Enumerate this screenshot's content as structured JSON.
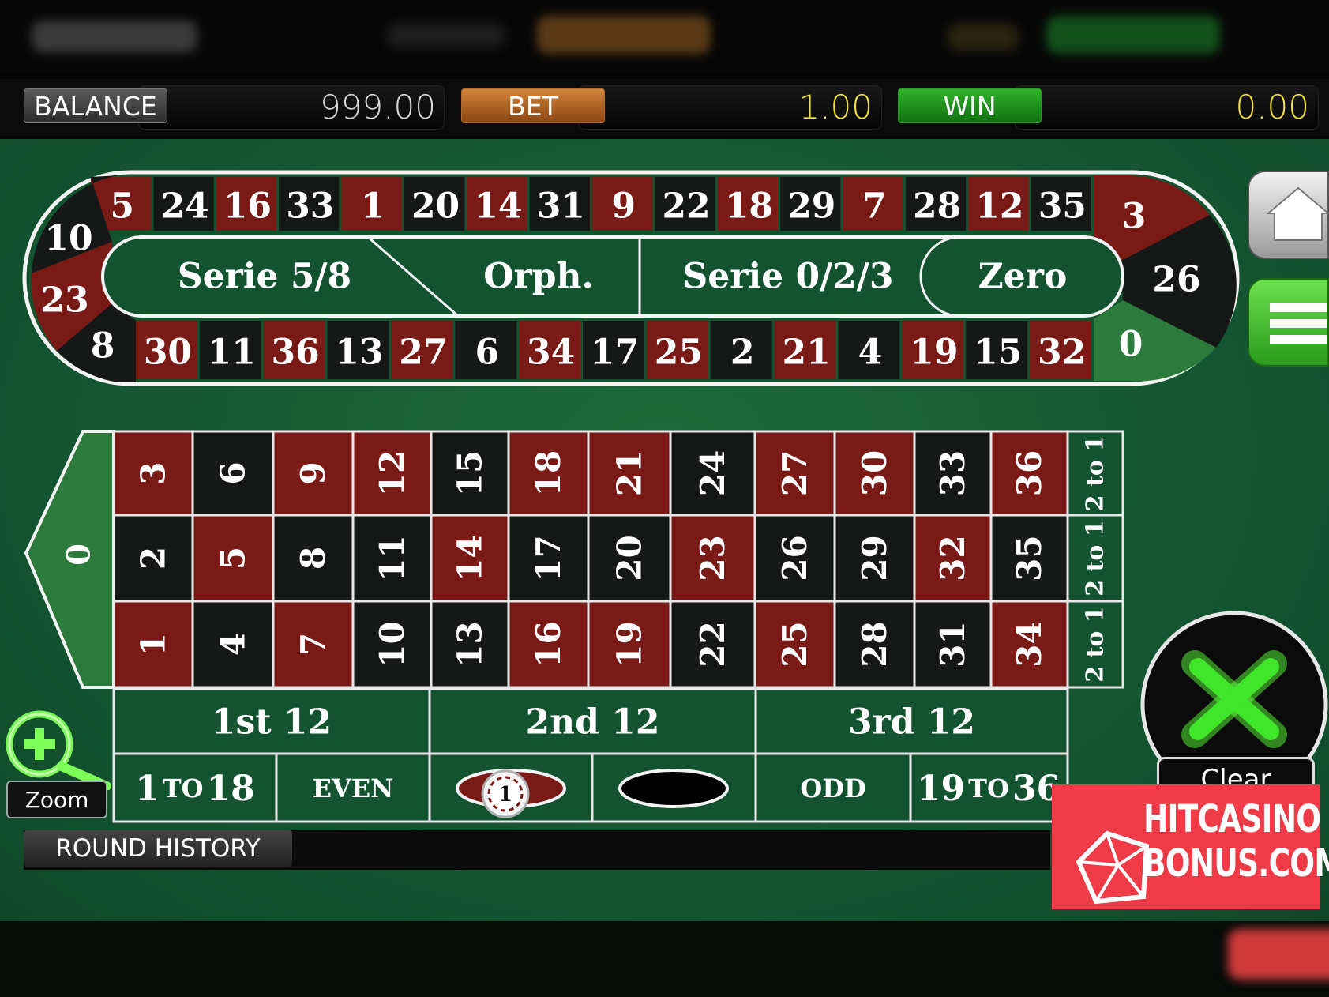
{
  "stats": {
    "balance_label": "BALANCE",
    "balance_value": "999.00",
    "bet_label": "BET",
    "bet_value": "1.00",
    "win_label": "WIN",
    "win_value": "0.00"
  },
  "racetrack": {
    "top_numbers": [
      "5",
      "24",
      "16",
      "33",
      "1",
      "20",
      "14",
      "31",
      "9",
      "22",
      "18",
      "29",
      "7",
      "28",
      "12",
      "35"
    ],
    "top_colors": [
      "red",
      "black",
      "red",
      "black",
      "red",
      "black",
      "red",
      "black",
      "red",
      "black",
      "red",
      "black",
      "red",
      "black",
      "red",
      "black"
    ],
    "bottom_numbers": [
      "30",
      "11",
      "36",
      "13",
      "27",
      "6",
      "34",
      "17",
      "25",
      "2",
      "21",
      "4",
      "19",
      "15",
      "32"
    ],
    "bottom_colors": [
      "red",
      "black",
      "red",
      "black",
      "red",
      "black",
      "red",
      "black",
      "red",
      "black",
      "red",
      "black",
      "red",
      "black",
      "red"
    ],
    "left_numbers": [
      "10",
      "23",
      "8"
    ],
    "right_numbers": [
      "3",
      "26",
      "0"
    ],
    "sections": [
      "Serie 5/8",
      "Orph.",
      "Serie 0/2/3",
      "Zero"
    ]
  },
  "table": {
    "zero": "0",
    "rows": [
      [
        "3",
        "6",
        "9",
        "12",
        "15",
        "18",
        "21",
        "24",
        "27",
        "30",
        "33",
        "36"
      ],
      [
        "2",
        "5",
        "8",
        "11",
        "14",
        "17",
        "20",
        "23",
        "26",
        "29",
        "32",
        "35"
      ],
      [
        "1",
        "4",
        "7",
        "10",
        "13",
        "16",
        "19",
        "22",
        "25",
        "28",
        "31",
        "34"
      ]
    ],
    "red_numbers": [
      1,
      3,
      5,
      7,
      9,
      12,
      14,
      16,
      18,
      19,
      21,
      23,
      25,
      27,
      30,
      32,
      34,
      36
    ],
    "column_bet_label": "2 to 1",
    "dozens": [
      "1st 12",
      "2nd 12",
      "3rd 12"
    ],
    "outside": {
      "low_a": "1",
      "low_b": "TO",
      "low_c": "18",
      "even": "EVEN",
      "odd": "ODD",
      "high_a": "19",
      "high_b": "TO",
      "high_c": "36"
    },
    "chip_value": "1"
  },
  "controls": {
    "zoom_label": "Zoom",
    "clear_label": "Clear",
    "round_history_label": "ROUND HISTORY"
  },
  "brand": {
    "text": "HITCASINO\nBONUS.COM"
  },
  "colors": {
    "felt": "#135330",
    "red": "#7a1a17",
    "black": "#151816",
    "track_green": "#135330",
    "gold": "#f0e33a",
    "bet_orange": "#b2601f",
    "win_green": "#1f8a1c",
    "brand_red": "#ef3b47"
  },
  "icons": [
    "home-icon",
    "menu-icon",
    "zoom-in-icon",
    "clear-x-icon",
    "diamond-icon"
  ]
}
